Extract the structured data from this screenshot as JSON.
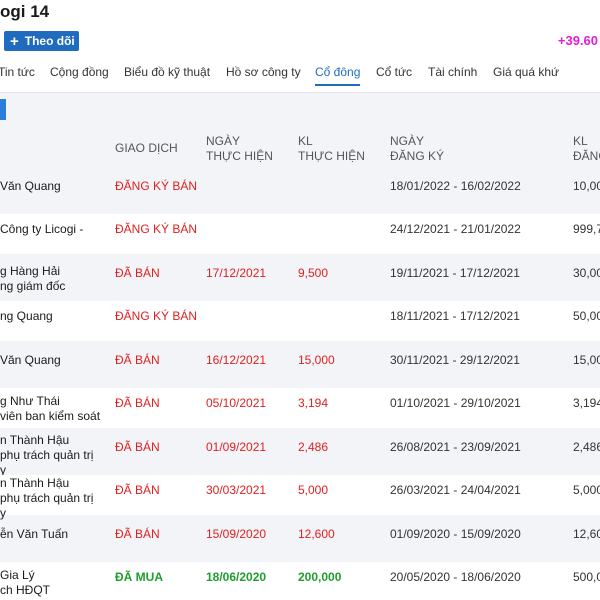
{
  "header": {
    "title": "ogi 14",
    "follow_label": "Theo dõi",
    "price_change": "+39.60"
  },
  "tabs": [
    "Tin tức",
    "Cộng đồng",
    "Biểu đồ kỹ thuật",
    "Hồ sơ công ty",
    "Cổ đông",
    "Cổ tức",
    "Tài chính",
    "Giá quá khứ"
  ],
  "active_tab": "Cổ đông",
  "table": {
    "headers": {
      "type": "GIAO DỊCH",
      "date_l1": "NGÀY",
      "date_l2": "THỰC HIỆN",
      "vol_l1": "KL",
      "vol_l2": "THỰC HIỆN",
      "reg_l1": "NGÀY",
      "reg_l2": "ĐĂNG KÝ",
      "regvol_l1": "KL",
      "regvol_l2": "ĐĂNG"
    },
    "rows": [
      {
        "name": "Văn Quang",
        "role": "",
        "role2": "",
        "type": "ĐĂNG KÝ BÁN",
        "date": "",
        "vol": "",
        "reg": "18/01/2022 - 16/02/2022",
        "regvol": "10,00"
      },
      {
        "name": "Công ty Licogi -",
        "role": "",
        "role2": "",
        "type": "ĐĂNG KÝ BÁN",
        "date": "",
        "vol": "",
        "reg": "24/12/2021 - 21/01/2022",
        "regvol": "999,7"
      },
      {
        "name": "g Hàng Hải",
        "role": "ng giám đốc",
        "role2": "",
        "type": "ĐÃ BÁN",
        "date": "17/12/2021",
        "vol": "9,500",
        "reg": "19/11/2021 - 17/12/2021",
        "regvol": "30,00"
      },
      {
        "name": "ng Quang",
        "role": "",
        "role2": "",
        "type": "ĐĂNG KÝ BÁN",
        "date": "",
        "vol": "",
        "reg": "18/11/2021 - 17/12/2021",
        "regvol": "50,00"
      },
      {
        "name": "Văn Quang",
        "role": "",
        "role2": "",
        "type": "ĐÃ BÁN",
        "date": "16/12/2021",
        "vol": "15,000",
        "reg": "30/11/2021 - 29/12/2021",
        "regvol": "15,00"
      },
      {
        "name": "g Như Thái",
        "role": "viên ban kiểm soát",
        "role2": "",
        "type": "ĐÃ BÁN",
        "date": "05/10/2021",
        "vol": "3,194",
        "reg": "01/10/2021 - 29/10/2021",
        "regvol": "3,194"
      },
      {
        "name": "n Thành Hậu",
        "role": "phụ trách quản trị",
        "role2": "y",
        "type": "ĐÃ BÁN",
        "date": "01/09/2021",
        "vol": "2,486",
        "reg": "26/08/2021 - 23/09/2021",
        "regvol": "2,486"
      },
      {
        "name": "n Thành Hậu",
        "role": "phụ trách quản trị",
        "role2": "y",
        "type": "ĐÃ BÁN",
        "date": "30/03/2021",
        "vol": "5,000",
        "reg": "26/03/2021 - 24/04/2021",
        "regvol": "5,000"
      },
      {
        "name": "ễn Văn Tuấn",
        "role": "",
        "role2": "",
        "type": "ĐÃ BÁN",
        "date": "15/09/2020",
        "vol": "12,600",
        "reg": "01/09/2020 - 15/09/2020",
        "regvol": "12,60"
      },
      {
        "name": "Gia Lý",
        "role": "ch HĐQT",
        "role2": "",
        "type": "ĐÃ MUA",
        "date": "18/06/2020",
        "vol": "200,000",
        "reg": "20/05/2020 - 18/06/2020",
        "regvol": "500,0"
      }
    ]
  },
  "colors": {
    "accent": "#1f6cbf",
    "sell": "#e02020",
    "buy": "#1e9e2e",
    "price_change": "#e020d8"
  }
}
